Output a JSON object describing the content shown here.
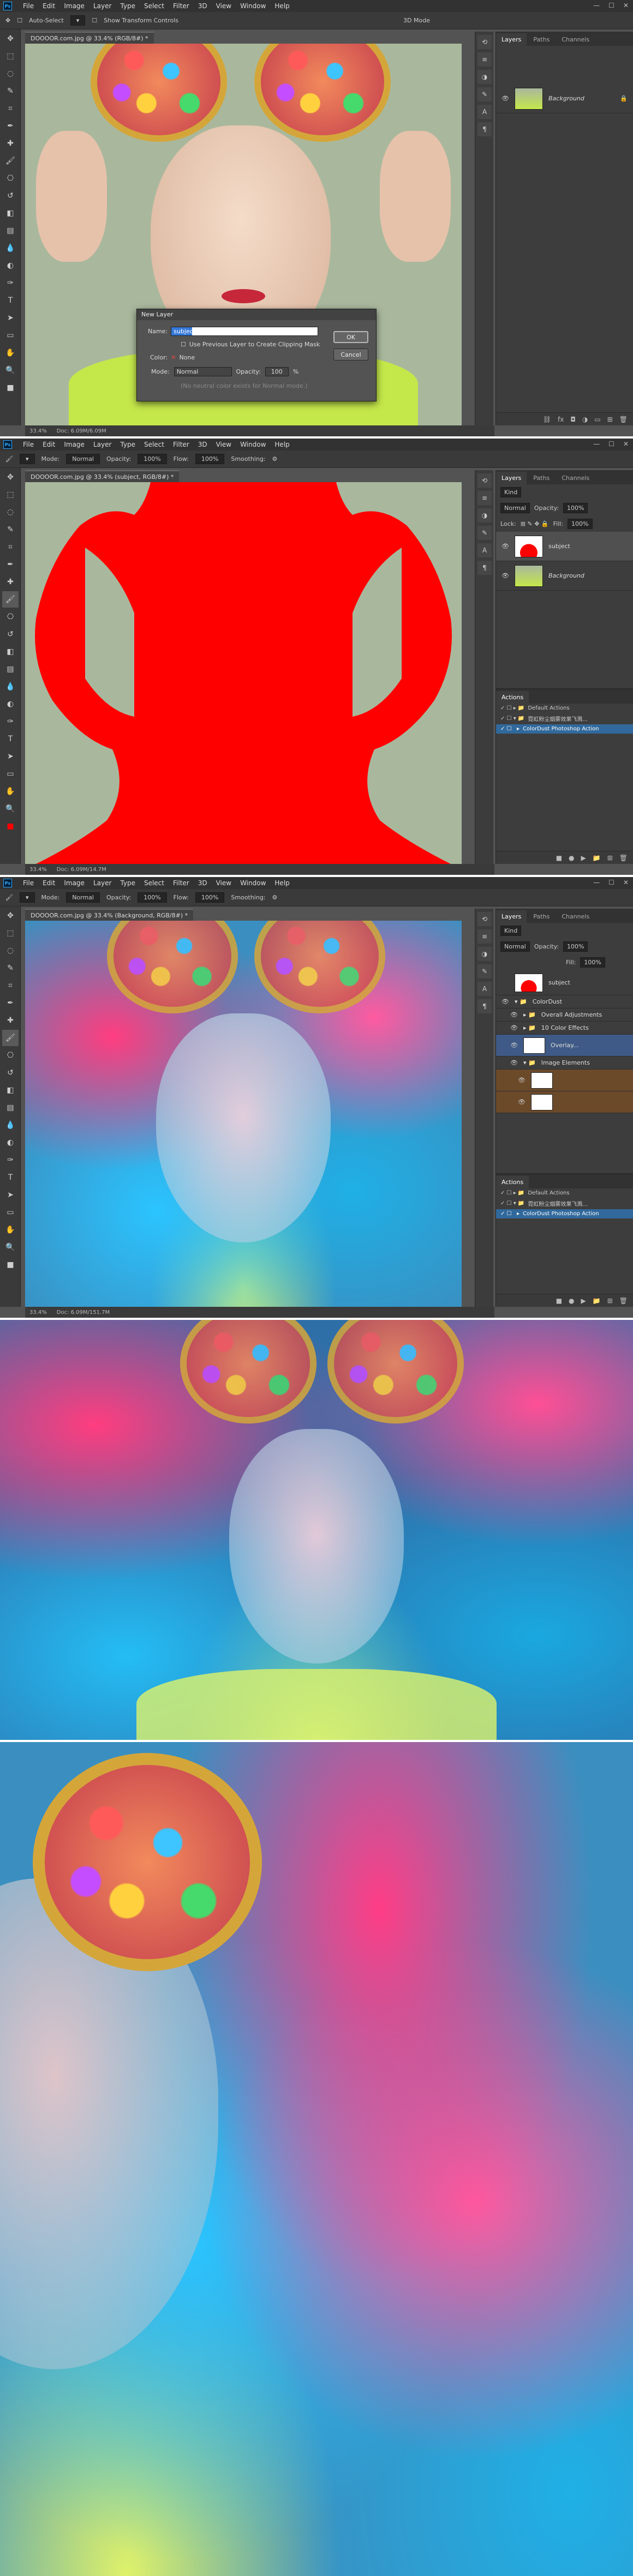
{
  "menu": [
    "File",
    "Edit",
    "Image",
    "Layer",
    "Type",
    "Select",
    "Filter",
    "3D",
    "View",
    "Window",
    "Help"
  ],
  "app_badge": "Ps",
  "window_controls": [
    "—",
    "☐",
    "✕"
  ],
  "screen1": {
    "options": {
      "auto_select": "Auto-Select",
      "show_transform": "Show Transform Controls",
      "mode3d": "3D Mode"
    },
    "doc_tab": "DOOOOR.com.jpg @ 33.4% (RGB/8#) *",
    "status": {
      "zoom": "33.4%",
      "doc": "Doc: 6.09M/6.09M"
    },
    "layers_tabs": [
      "Layers",
      "Paths",
      "Channels"
    ],
    "layers": [
      {
        "name": "Background"
      }
    ],
    "dialog": {
      "title": "New Layer",
      "name_label": "Name:",
      "name_value": "subject",
      "clip_label": "Use Previous Layer to Create Clipping Mask",
      "color_label": "Color:",
      "color_value": "None",
      "mode_label": "Mode:",
      "mode_value": "Normal",
      "opacity_label": "Opacity:",
      "opacity_value": "100",
      "opacity_unit": "%",
      "neutral_label": "(No neutral color exists for Normal mode.)",
      "ok": "OK",
      "cancel": "Cancel"
    }
  },
  "screen2": {
    "options": {
      "mode_label": "Mode:",
      "mode_value": "Normal",
      "opacity_label": "Opacity:",
      "opacity_value": "100%",
      "flow_label": "Flow:",
      "flow_value": "100%",
      "smoothing": "Smoothing:"
    },
    "doc_tab": "DOOOOR.com.jpg @ 33.4% (subject, RGB/8#) *",
    "status": {
      "zoom": "33.4%",
      "doc": "Doc: 6.09M/14.7M"
    },
    "layers_tabs": [
      "Layers",
      "Paths",
      "Channels"
    ],
    "kind": "Kind",
    "blend": "Normal",
    "opacity_label": "Opacity:",
    "opacity_value": "100%",
    "lock_label": "Lock:",
    "fill_label": "Fill:",
    "fill_value": "100%",
    "layers": [
      {
        "name": "subject"
      },
      {
        "name": "Background"
      }
    ],
    "actions_title": "Actions",
    "actions": [
      "Default Actions",
      "霓虹粉尘烟雾效果飞溅...",
      "ColorDust Photoshop Action"
    ]
  },
  "screen3": {
    "options": {
      "mode_label": "Mode:",
      "mode_value": "Normal",
      "opacity_label": "Opacity:",
      "opacity_value": "100%",
      "flow_label": "Flow:",
      "flow_value": "100%",
      "smoothing": "Smoothing:"
    },
    "doc_tab": "DOOOOR.com.jpg @ 33.4% (Background, RGB/8#) *",
    "status": {
      "zoom": "33.4%",
      "doc": "Doc: 6.09M/151.7M"
    },
    "layers_tabs": [
      "Layers",
      "Paths",
      "Channels"
    ],
    "kind": "Kind",
    "blend": "Normal",
    "opacity_label": "Opacity:",
    "opacity_value": "100%",
    "fill_label": "Fill:",
    "fill_value": "100%",
    "layers": [
      {
        "name": "subject"
      },
      {
        "name": "ColorDust"
      },
      {
        "name": "Overall Adjustments"
      },
      {
        "name": "10 Color Effects"
      },
      {
        "name": "Overlay..."
      },
      {
        "name": "Image Elements"
      }
    ],
    "actions_title": "Actions",
    "actions": [
      "Default Actions",
      "霓虹粉尘烟雾效果飞溅...",
      "ColorDust Photoshop Action"
    ]
  },
  "colors": {
    "chrome": "#535353",
    "menubar": "#323232",
    "accent": "#31a8ff",
    "red_mask": "#ff0000",
    "selected_action": "#31699c"
  }
}
